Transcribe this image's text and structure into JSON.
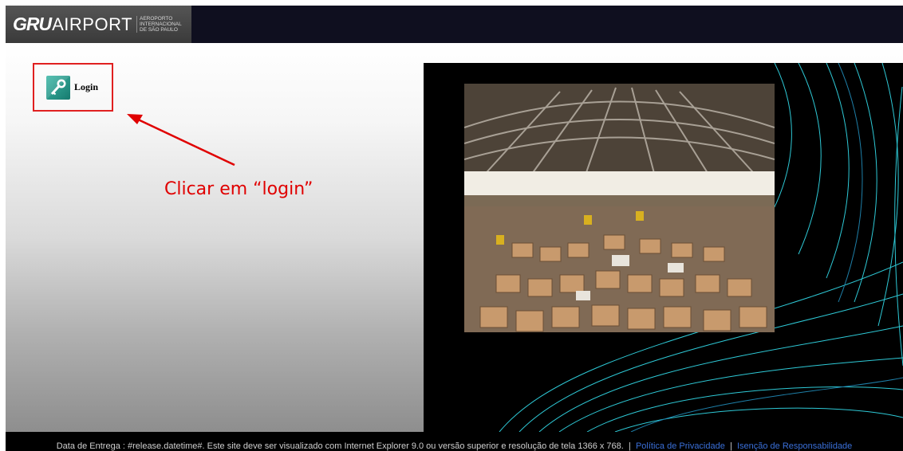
{
  "header": {
    "logo_bold": "GRU",
    "logo_name": "AIRPORT",
    "logo_sub": [
      "AEROPORTO",
      "INTERNACIONAL",
      "DE SÃO PAULO"
    ]
  },
  "login": {
    "label": "Login"
  },
  "annotation": {
    "text": "Clicar em “login”"
  },
  "footer": {
    "text": "Data de Entrega : #release.datetime#. Este site deve ser visualizado com Internet Explorer 9.0 ou versão superior e resolução de tela 1366 x 768.",
    "separator": "|",
    "privacy_link": "Política de Privacidade",
    "responsibility_link": "Isenção de Responsabilidade",
    "link_color": "#3a6fd8"
  },
  "colors": {
    "topbar": "#0f0f1f",
    "annotation_red": "#e00000",
    "curve_cyan": "#2ec9d6"
  }
}
